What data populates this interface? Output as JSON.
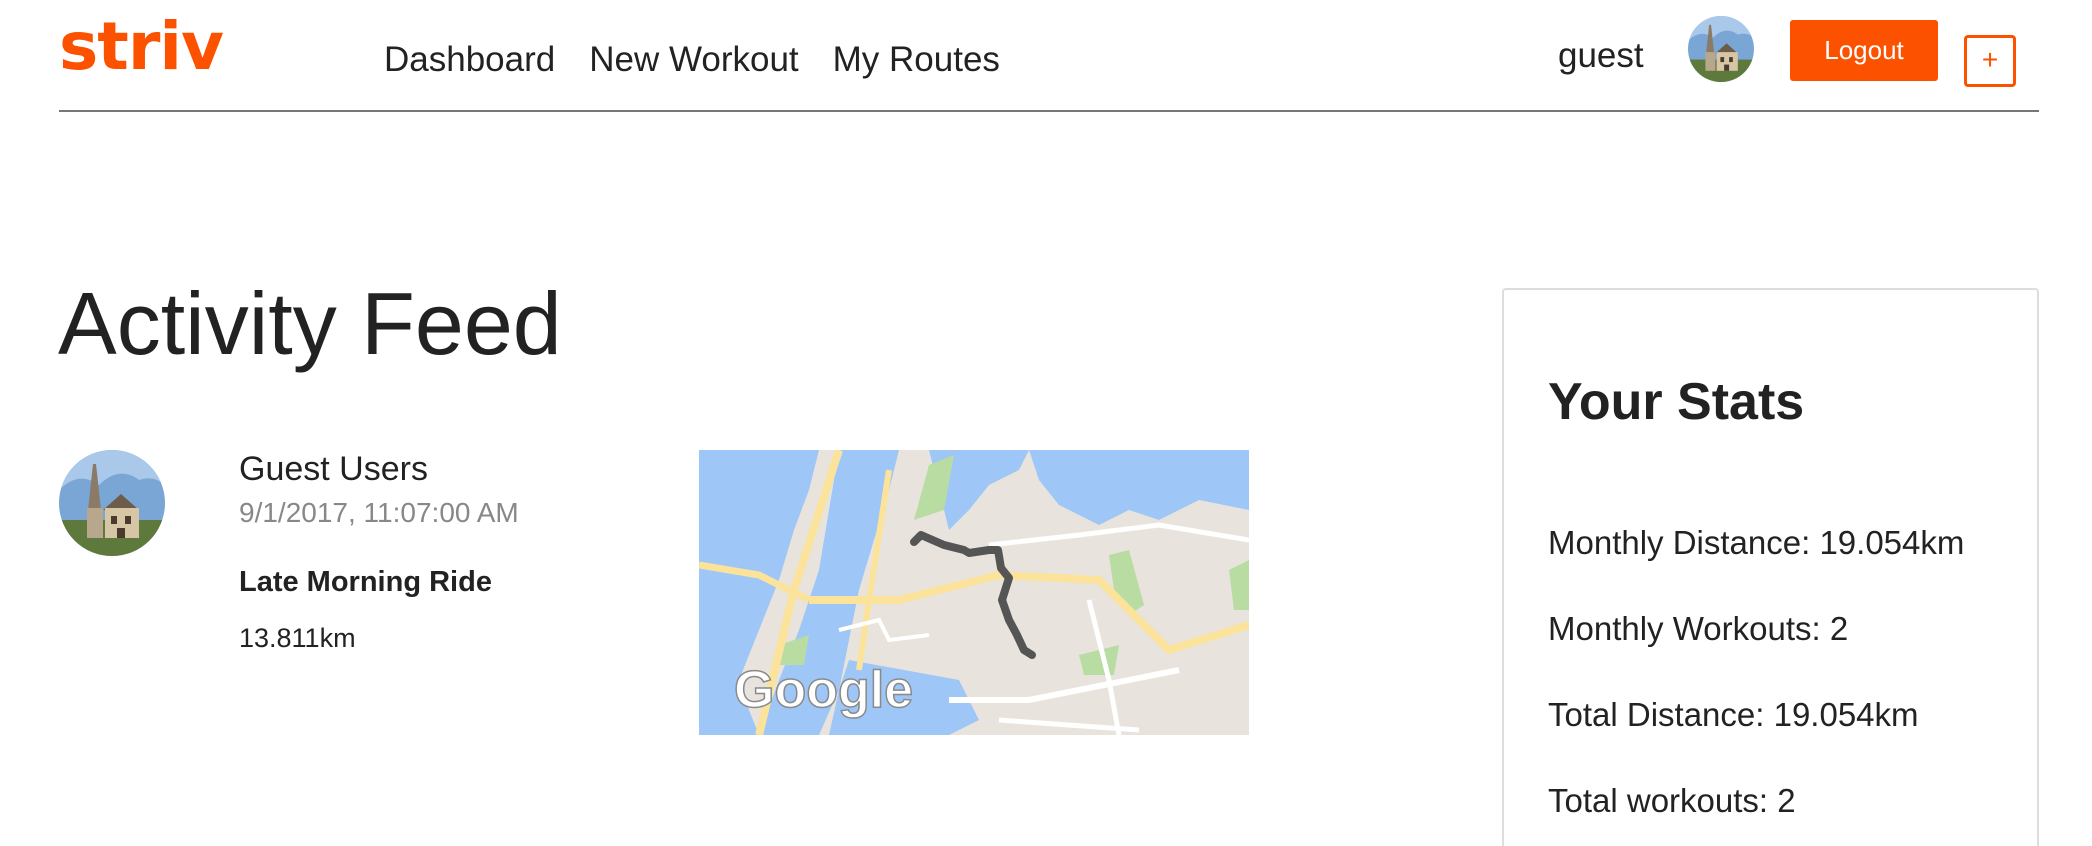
{
  "header": {
    "logo": "striv",
    "nav": [
      "Dashboard",
      "New Workout",
      "My Routes"
    ],
    "username": "guest",
    "logout_label": "Logout",
    "add_label": "+"
  },
  "colors": {
    "brand": "#fc5200",
    "water": "#9ec6f7",
    "land": "#e8e4dd",
    "park": "#b9dca2",
    "road_major": "#fbe39b",
    "route": "#555555"
  },
  "main": {
    "title": "Activity Feed",
    "feed": [
      {
        "user": "Guest Users",
        "date": "9/1/2017, 11:07:00 AM",
        "activity": "Late Morning Ride",
        "distance": "13.811km",
        "map_watermark": "Google"
      }
    ]
  },
  "stats": {
    "title": "Your Stats",
    "items": [
      "Monthly Distance: 19.054km",
      "Monthly Workouts: 2",
      "Total Distance: 19.054km",
      "Total workouts: 2"
    ]
  }
}
